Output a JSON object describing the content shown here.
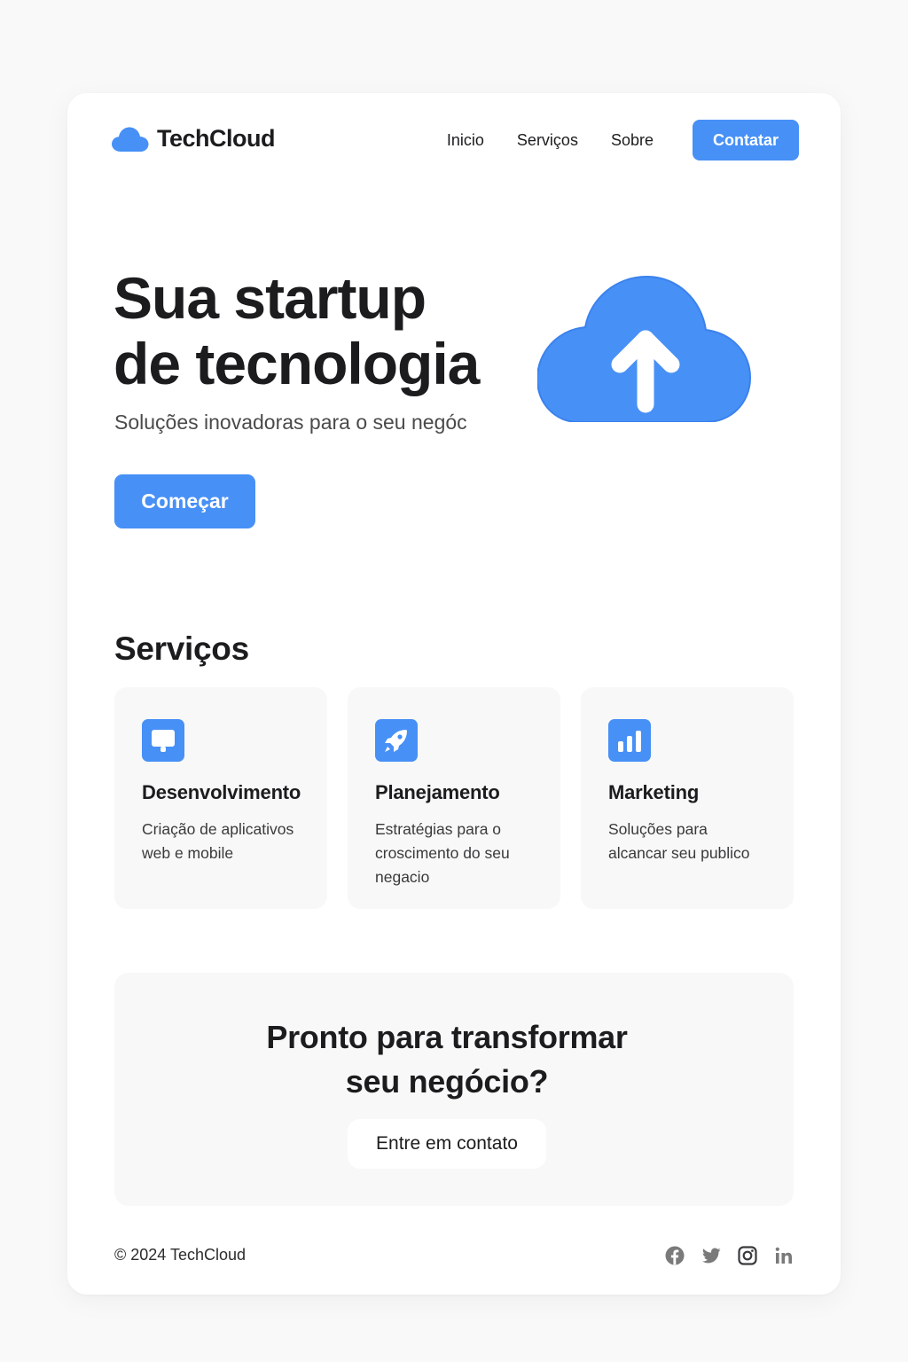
{
  "colors": {
    "accent": "#4790f6",
    "page_background": "#f9f9f9",
    "card_background": "#ffffff",
    "panel_background": "#f8f8f8",
    "text_primary": "#1c1c1e",
    "text_secondary": "#4a4a4a",
    "social_icon": "#7a7a7a"
  },
  "header": {
    "logo_icon": "cloud-icon",
    "brand_name": "TechCloud",
    "nav": {
      "items": [
        {
          "label": "Inicio"
        },
        {
          "label": "Serviços"
        },
        {
          "label": "Sobre"
        }
      ],
      "cta_label": "Contatar"
    }
  },
  "hero": {
    "title_line1": "Sua startup",
    "title_line2": "de tecnologia",
    "subtitle": "Soluções inovadoras para o seu negóc",
    "button_label": "Começar",
    "illustration_icon": "cloud-upload-icon"
  },
  "services": {
    "heading": "Serviços",
    "items": [
      {
        "icon": "monitor-icon",
        "title": "Desenvolvimento",
        "desc_line1": "Criação de aplicativos",
        "desc_line2": "web e mobile",
        "desc_line3": ""
      },
      {
        "icon": "rocket-icon",
        "title": "Planejamento",
        "desc_line1": "Estratégias para o",
        "desc_line2": "croscimento do seu",
        "desc_line3": "negacio"
      },
      {
        "icon": "bar-chart-icon",
        "title": "Marketing",
        "desc_line1": "Soluções para",
        "desc_line2": "alcancar seu publico",
        "desc_line3": ""
      }
    ]
  },
  "cta": {
    "title_line1": "Pronto para transformar",
    "title_line2": "seu negócio?",
    "button_label": "Entre em contato"
  },
  "footer": {
    "copyright": "© 2024 TechCloud",
    "social": [
      {
        "icon": "facebook-icon"
      },
      {
        "icon": "twitter-icon"
      },
      {
        "icon": "instagram-icon"
      },
      {
        "icon": "linkedin-icon"
      }
    ]
  }
}
